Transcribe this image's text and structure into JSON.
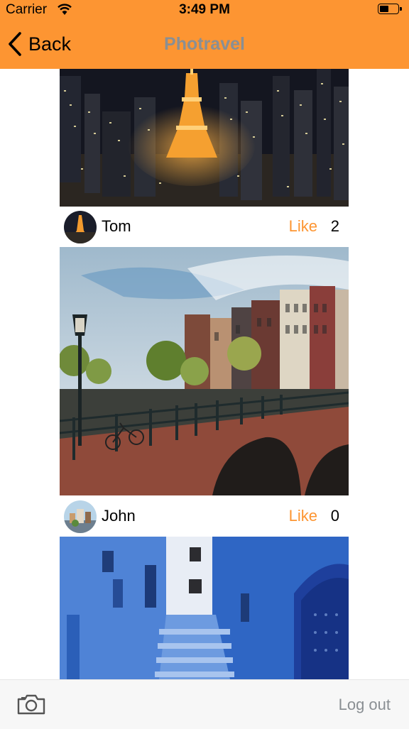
{
  "status_bar": {
    "carrier": "Carrier",
    "time": "3:49 PM"
  },
  "nav": {
    "back_label": "Back",
    "title": "Photravel"
  },
  "posts": [
    {
      "user": "Tom",
      "like_label": "Like",
      "likes": "2"
    },
    {
      "user": "John",
      "like_label": "Like",
      "likes": "0"
    }
  ],
  "tab_bar": {
    "logout_label": "Log out"
  },
  "colors": {
    "accent": "#fd9532",
    "title_gray": "#8a8f93"
  }
}
